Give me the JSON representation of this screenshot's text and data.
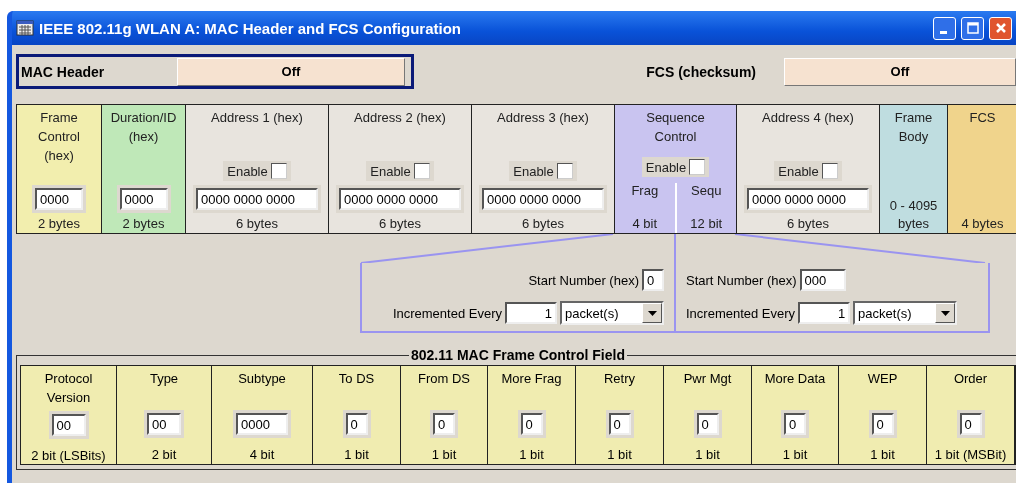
{
  "window": {
    "title": "IEEE 802.11g WLAN A: MAC Header and FCS Configuration"
  },
  "mac_header": {
    "label": "MAC Header",
    "value": "Off"
  },
  "fcs": {
    "label": "FCS (checksum)",
    "value": "Off"
  },
  "header_fields": [
    {
      "kind": "value",
      "title": "Frame Control (hex)",
      "value": "0000",
      "size": "2 bytes",
      "color": "#f2eeae"
    },
    {
      "kind": "value",
      "title": "Duration/ID (hex)",
      "value": "0000",
      "size": "2 bytes",
      "color": "#bfe8b8"
    },
    {
      "kind": "address",
      "title": "Address 1 (hex)",
      "enable": {
        "label": "Enable",
        "checked": false
      },
      "value": "0000 0000 0000",
      "size": "6 bytes",
      "color": "#e8e4de"
    },
    {
      "kind": "address",
      "title": "Address 2 (hex)",
      "enable": {
        "label": "Enable",
        "checked": false
      },
      "value": "0000 0000 0000",
      "size": "6 bytes",
      "color": "#e8e4de"
    },
    {
      "kind": "address",
      "title": "Address 3 (hex)",
      "enable": {
        "label": "Enable",
        "checked": false
      },
      "value": "0000 0000 0000",
      "size": "6 bytes",
      "color": "#e8e4de"
    },
    {
      "kind": "sequence",
      "title": "Sequence Control",
      "enable": {
        "label": "Enable",
        "checked": false
      },
      "color": "#c9c4f0",
      "subfields": [
        {
          "label": "Frag",
          "size": "4 bit"
        },
        {
          "label": "Sequ",
          "size": "12 bit"
        }
      ]
    },
    {
      "kind": "address",
      "title": "Address 4 (hex)",
      "enable": {
        "label": "Enable",
        "checked": false
      },
      "value": "0000 0000 0000",
      "size": "6 bytes",
      "color": "#e8e4de"
    },
    {
      "kind": "body",
      "title": "Frame Body",
      "size": "0 - 4095 bytes",
      "color": "#bfdde0"
    },
    {
      "kind": "body",
      "title": "FCS",
      "size": "4 bytes",
      "color": "#f0d48c"
    }
  ],
  "sequence_settings": [
    {
      "start_label": "Start Number (hex)",
      "start_value": "0",
      "increment_label": "Incremented Every",
      "increment_value": "1",
      "unit": "packet(s)"
    },
    {
      "start_label": "Start Number (hex)",
      "start_value": "000",
      "increment_label": "Incremented Every",
      "increment_value": "1",
      "unit": "packet(s)"
    }
  ],
  "frame_control": {
    "title": "802.11 MAC Frame Control Field",
    "fields": [
      {
        "title": "Protocol Version",
        "value": "00",
        "size": "2 bit (LSBits)"
      },
      {
        "title": "Type",
        "value": "00",
        "size": "2 bit"
      },
      {
        "title": "Subtype",
        "value": "0000",
        "size": "4 bit"
      },
      {
        "title": "To DS",
        "value": "0",
        "size": "1 bit"
      },
      {
        "title": "From DS",
        "value": "0",
        "size": "1 bit"
      },
      {
        "title": "More Frag",
        "value": "0",
        "size": "1 bit"
      },
      {
        "title": "Retry",
        "value": "0",
        "size": "1 bit"
      },
      {
        "title": "Pwr Mgt",
        "value": "0",
        "size": "1 bit"
      },
      {
        "title": "More Data",
        "value": "0",
        "size": "1 bit"
      },
      {
        "title": "WEP",
        "value": "0",
        "size": "1 bit"
      },
      {
        "title": "Order",
        "value": "0",
        "size": "1 bit (MSBit)"
      }
    ]
  }
}
